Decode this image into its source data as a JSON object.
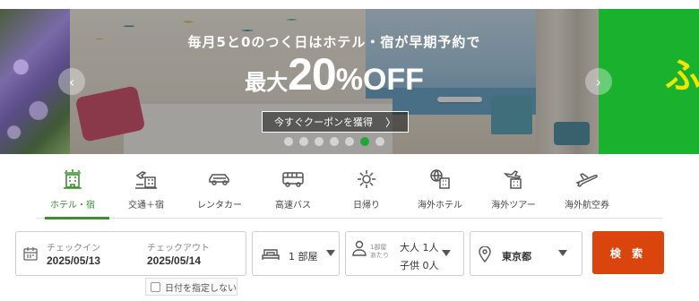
{
  "banner": {
    "subtitle": "毎月5と0のつく日はホテル・宿が早期予約で",
    "prefix": "最大",
    "number": "20",
    "percent": "%",
    "suffix": "OFF",
    "coupon_button": "今すぐクーポンを獲得",
    "next_banner_glyph": "ふ",
    "slide_count": 7,
    "active_slide": 6
  },
  "tabs": [
    {
      "label": "ホテル・宿",
      "icon": "hotel-icon"
    },
    {
      "label": "交通＋宿",
      "icon": "train-hotel-icon"
    },
    {
      "label": "レンタカー",
      "icon": "car-icon"
    },
    {
      "label": "高速バス",
      "icon": "bus-icon"
    },
    {
      "label": "日帰り",
      "icon": "sun-icon"
    },
    {
      "label": "海外ホテル",
      "icon": "globe-building-icon"
    },
    {
      "label": "海外ツアー",
      "icon": "plane-building-icon"
    },
    {
      "label": "海外航空券",
      "icon": "airplane-icon"
    }
  ],
  "search": {
    "checkin_label": "チェックイン",
    "checkin_value": "2025/05/13",
    "checkout_label": "チェックアウト",
    "checkout_value": "2025/05/14",
    "rooms": "1 部屋",
    "per_room_1": "1部屋",
    "per_room_2": "あたり",
    "adults": "大人 1人",
    "children": "子供  0人",
    "area": "東京都",
    "search_button": "検 索",
    "no_date_label": "日付を指定しない"
  },
  "colors": {
    "accent_green": "#3d8f30",
    "search_orange": "#d9450c",
    "active_dot": "#22a63a"
  }
}
